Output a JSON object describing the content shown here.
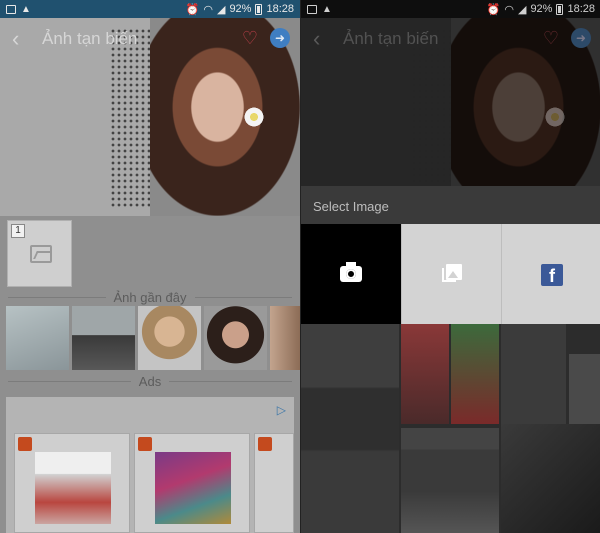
{
  "status": {
    "battery": "92%",
    "time": "18:28"
  },
  "left": {
    "title": "Ảnh tạn biến",
    "slot_number": "1",
    "recent_label": "Ảnh gần đây",
    "ads_label": "Ads"
  },
  "right": {
    "title": "Ảnh tạn biến",
    "modal": {
      "title": "Select Image",
      "options": [
        "camera",
        "gallery",
        "facebook"
      ]
    }
  },
  "icons": {
    "back": "chevron-left",
    "favorite": "heart",
    "next": "arrow-right",
    "camera": "camera",
    "gallery": "gallery",
    "facebook": "facebook"
  },
  "colors": {
    "status_bar": "#20516f",
    "heart": "#c0404b",
    "next_button": "#3f7ec2",
    "facebook": "#3b5998"
  }
}
